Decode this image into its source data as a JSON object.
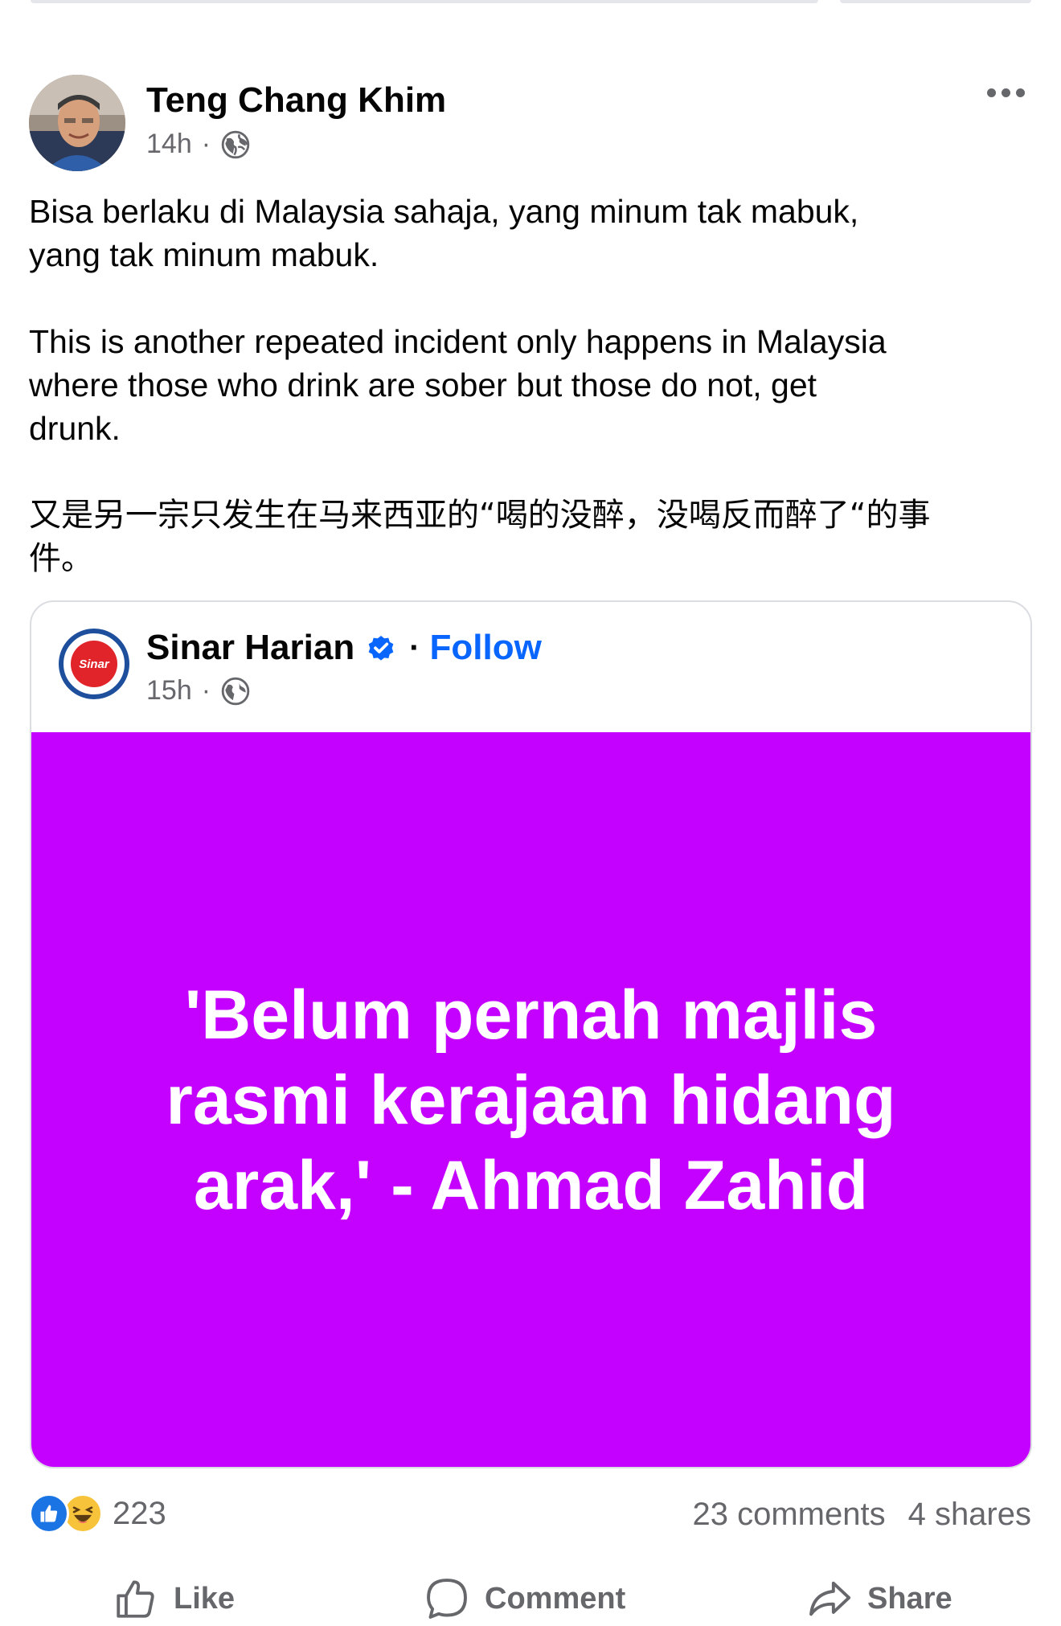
{
  "post": {
    "author": "Teng Chang Khim",
    "time": "14h",
    "privacy_icon": "globe-icon",
    "paragraphs": [
      "Bisa berlaku di Malaysia sahaja, yang minum tak mabuk,\nyang tak minum mabuk.",
      "This is another repeated incident only happens in Malaysia\nwhere those who drink are sober but those do not, get\ndrunk.",
      "又是另一宗只发生在马来西亚的“喝的没醉，没喝反而醉了“的事\n件。"
    ]
  },
  "shared": {
    "page_name": "Sinar Harian",
    "follow_label": "Follow",
    "time": "15h",
    "logo_text": "Sinar",
    "headline": "'Belum pernah majlis\nrasmi kerajaan hidang\narak,' - Ahmad Zahid",
    "panel_color": "#c400ff"
  },
  "stats": {
    "reactions": "223",
    "comments": "23 comments",
    "shares": "4 shares"
  },
  "actions": {
    "like": "Like",
    "comment": "Comment",
    "share": "Share"
  },
  "colors": {
    "accent": "#0866ff",
    "muted": "#65676b"
  }
}
